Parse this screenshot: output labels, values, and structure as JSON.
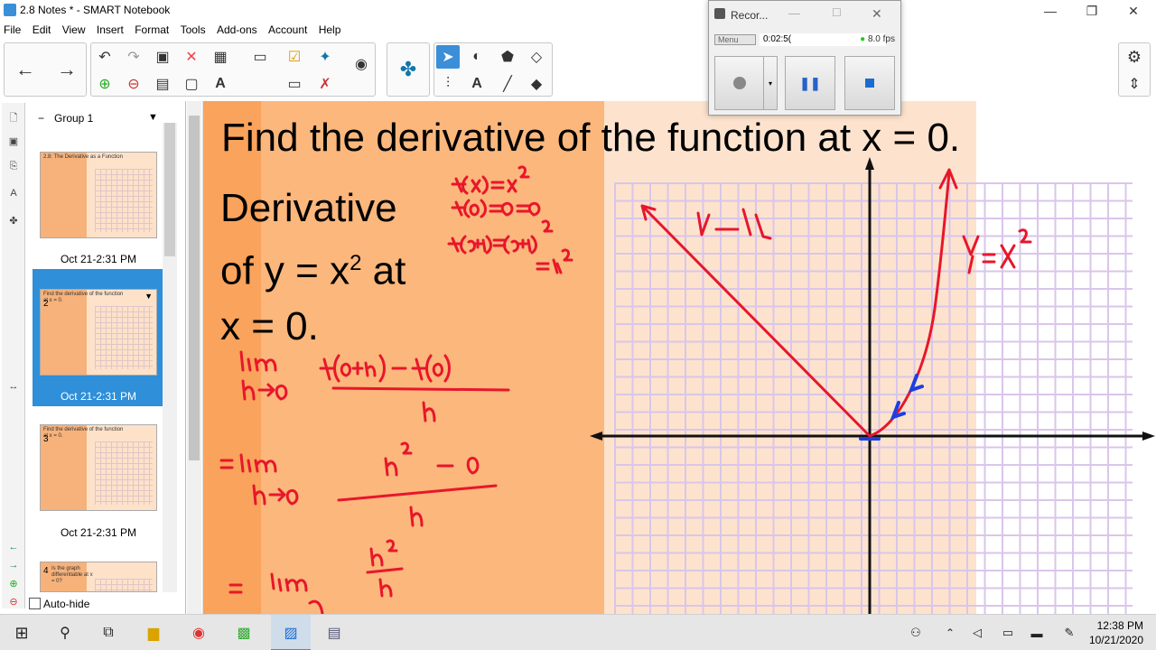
{
  "window": {
    "title": "2.8 Notes * - SMART Notebook"
  },
  "menu": [
    "File",
    "Edit",
    "View",
    "Insert",
    "Format",
    "Tools",
    "Add-ons",
    "Account",
    "Help"
  ],
  "recorder": {
    "title": "Recor...",
    "menu_label": "Menu",
    "time": "0:02:5(",
    "fps": "8.0 fps"
  },
  "sidebar": {
    "group_label": "Group 1",
    "pages": [
      {
        "num": "",
        "date": "Oct 21-2:31 PM",
        "mini_title": "2.8: The Derivative as a Function"
      },
      {
        "num": "2",
        "date": "Oct 21-2:31 PM",
        "mini_title": "Find the derivative of the function at x = 0."
      },
      {
        "num": "3",
        "date": "Oct 21-2:31 PM",
        "mini_title": "Find the derivative of the function at x = 0."
      },
      {
        "num": "4",
        "date": "",
        "mini_title": "Is the graph differentiable at x = 0?"
      }
    ],
    "auto_hide_label": "Auto-hide"
  },
  "slide": {
    "heading": "Find the derivative of the function at x = 0.",
    "deriv_line1": "Derivative",
    "deriv_line2a": "of y = x",
    "deriv_line2_sup": "2",
    "deriv_line2b": " at",
    "deriv_line3": "x = 0."
  },
  "taskbar": {
    "time": "12:38 PM",
    "date": "10/21/2020"
  },
  "colors": {
    "accent": "#3b8ed8",
    "ink_red": "#e8162b",
    "ink_blue": "#1d3fe0"
  }
}
